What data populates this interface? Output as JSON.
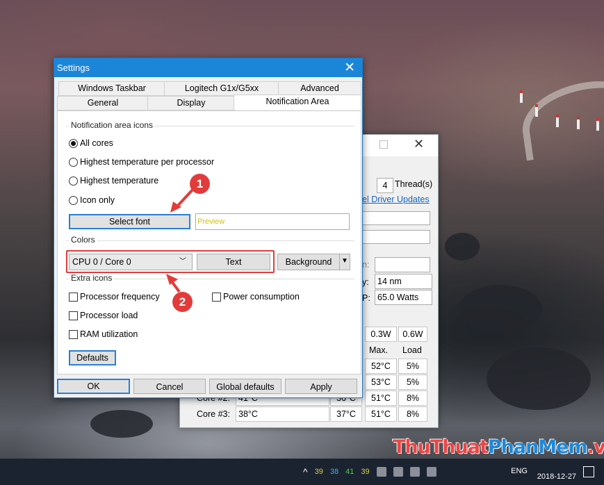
{
  "settings_dialog": {
    "title": "Settings",
    "tabs_row1": [
      "Windows Taskbar",
      "Logitech G1x/G5xx",
      "Advanced"
    ],
    "tabs_row2": [
      "General",
      "Display",
      "Notification Area"
    ],
    "active_tab": "Notification Area",
    "notification_group": {
      "label": "Notification area icons",
      "options": [
        "All cores",
        "Highest temperature per processor",
        "Highest temperature",
        "Icon only"
      ],
      "selected": "All cores"
    },
    "select_font_label": "Select font",
    "preview_text": "Preview",
    "colors_group": {
      "label": "Colors",
      "combo_value": "CPU 0 / Core 0",
      "text_button": "Text",
      "background_button": "Background"
    },
    "extra_icons_group": {
      "label": "Extra icons",
      "items": [
        "Processor frequency",
        "Power consumption",
        "Processor load",
        "RAM utilization"
      ]
    },
    "defaults_button": "Defaults",
    "bottom_buttons": {
      "ok": "OK",
      "cancel": "Cancel",
      "global_defaults": "Global defaults",
      "apply": "Apply"
    }
  },
  "annotations": {
    "marker1": "1",
    "marker2": "2"
  },
  "background_window": {
    "thread_count": "4",
    "thread_label": "Thread(s)",
    "driver_link": "el Driver Updates",
    "litho_label": "y:",
    "litho_value": "14 nm",
    "tdp_label": "P:",
    "tdp_value": "65.0 Watts",
    "power_values": [
      "0.3W",
      "0.6W"
    ],
    "col_headers": [
      "Max.",
      "Load"
    ],
    "rows": [
      {
        "max": "52°C",
        "load": "5%"
      },
      {
        "max": "53°C",
        "load": "5%"
      },
      {
        "label": "Core #2:",
        "temp": "41°C",
        "min": "36°C",
        "max": "51°C",
        "load": "8%"
      },
      {
        "label": "Core #3:",
        "temp": "38°C",
        "min": "37°C",
        "max": "51°C",
        "load": "8%"
      }
    ]
  },
  "taskbar": {
    "tray_temps": [
      "39",
      "38",
      "41",
      "39"
    ],
    "language": "ENG",
    "date": "2018-12-27"
  },
  "watermark": {
    "part1": "ThuThuat",
    "part2": "PhanMem",
    "part3": ".vn"
  }
}
